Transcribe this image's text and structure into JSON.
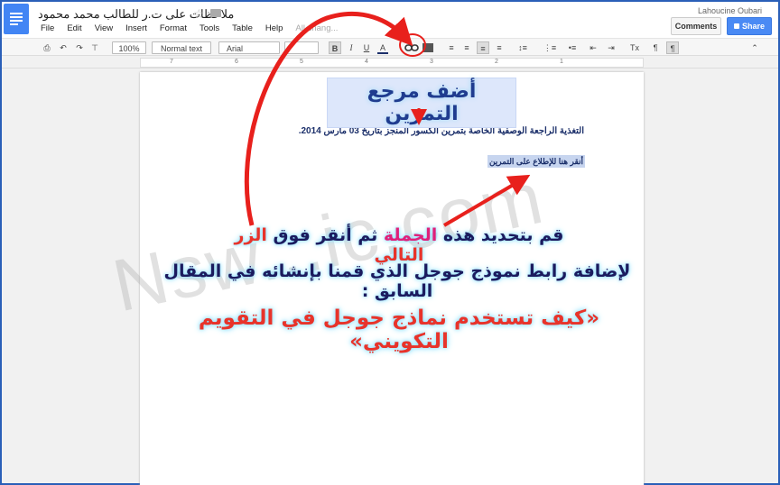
{
  "window": {
    "doc_title": "ملاحظات على ت.ر للطالب محمد محمود",
    "user_name": "Lahoucine Oubari",
    "buttons": {
      "comments": "Comments",
      "share": "Share"
    }
  },
  "menu": {
    "items": [
      "File",
      "Edit",
      "View",
      "Insert",
      "Format",
      "Tools",
      "Table",
      "Help"
    ],
    "status": "All chang..."
  },
  "toolbar": {
    "zoom": "100%",
    "style": "Normal text",
    "font": "Arial",
    "bold": "B",
    "italic": "I",
    "underline": "U",
    "text_color": "A",
    "clear_format": "Tx",
    "ltr": "¶",
    "rtl": "¶"
  },
  "ruler": {
    "marks": [
      "7",
      "6",
      "5",
      "4",
      "3",
      "2",
      "1"
    ]
  },
  "document": {
    "line1": "التغذية الراجعة الوصفية الخاصة بتمرين الكسور المنجز بتاريخ 03 مارس 2014.",
    "link_text": "أنقر هنا للإطلاع على التمرين"
  },
  "annotation": {
    "title": "أضف مرجع التمرين",
    "line1_a": "قم بتحديد هذه",
    "line1_b": "الجملة",
    "line1_c": "ثم أنقر فوق",
    "line1_d": "الزر التالي",
    "line2": "لإضافة رابط نموذج جوجل الذي  قمنا بإنشائه في المقال السابق :",
    "line3": "«كيف تستخدم نماذج جوجل في التقويم التكويني»"
  },
  "watermark": "Nsw...ic.com",
  "colors": {
    "accent_red": "#e8332a",
    "share_blue": "#4a8af4",
    "docs_blue": "#4285f4"
  }
}
